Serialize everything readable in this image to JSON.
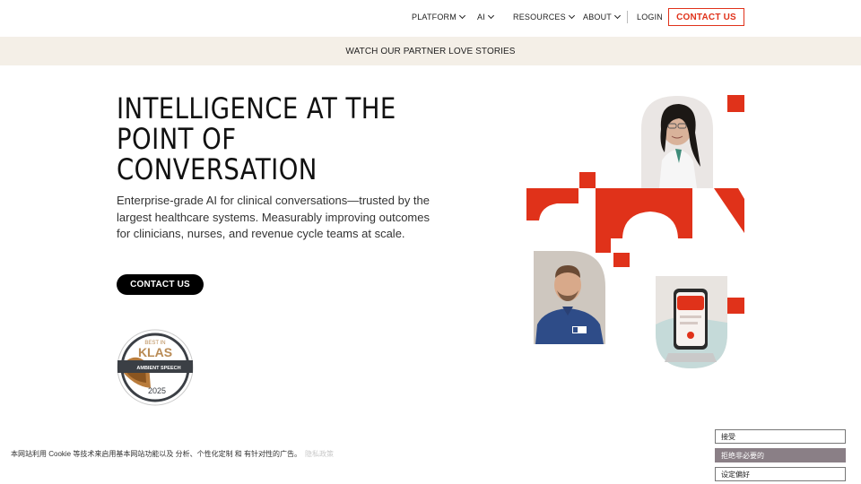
{
  "nav": {
    "items": [
      {
        "label": "PLATFORM",
        "has_dropdown": true
      },
      {
        "label": "AI",
        "has_dropdown": true
      },
      {
        "label": "RESOURCES",
        "has_dropdown": true
      },
      {
        "label": "ABOUT",
        "has_dropdown": true
      }
    ],
    "login": "LOGIN",
    "contact": "CONTACT US"
  },
  "banner": {
    "text": "WATCH OUR PARTNER LOVE STORIES"
  },
  "hero": {
    "title_lines": [
      "INTELLIGENCE AT THE",
      "POINT OF",
      "CONVERSATION"
    ],
    "description": "Enterprise-grade AI for clinical conversations—trusted by the largest healthcare systems. Measurably improving outcomes for clinicians, nurses, and revenue cycle teams at scale.",
    "cta": "CONTACT US"
  },
  "badge": {
    "top": "BEST IN",
    "brand": "KLAS",
    "category": "AMBIENT SPEECH",
    "year": "2025"
  },
  "cookie": {
    "text": "本网站利用 Cookie 等技术来启用基本网站功能以及 分析、个性化定制 和 有针对性的广告。",
    "more": "隐私政策",
    "accept": "接受",
    "reject": "拒绝非必要的",
    "preferences": "设定偏好"
  },
  "colors": {
    "accent": "#e0321a",
    "banner_bg": "#f4efe7",
    "reject_bg": "#8a7f86"
  }
}
